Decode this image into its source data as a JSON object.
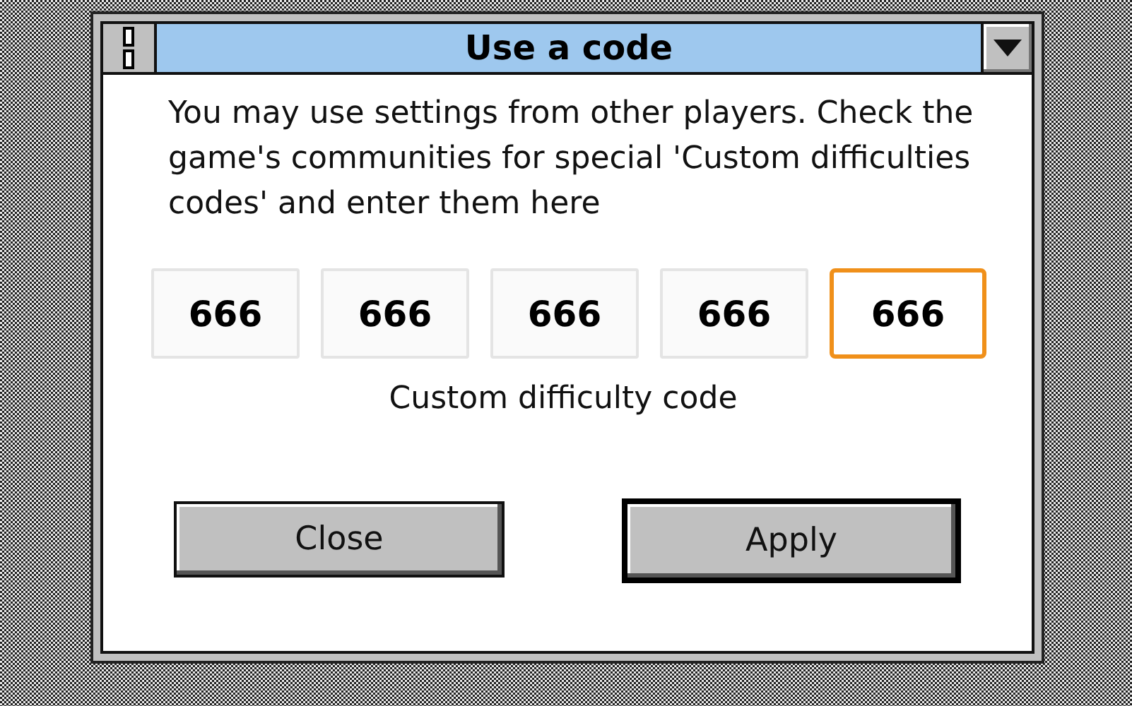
{
  "window": {
    "title": "Use a code"
  },
  "message": "You may use settings from other players. Check the game's communities for special 'Custom difficulties codes' and enter them here",
  "code_fields": [
    {
      "value": "666",
      "focused": false
    },
    {
      "value": "666",
      "focused": false
    },
    {
      "value": "666",
      "focused": false
    },
    {
      "value": "666",
      "focused": false
    },
    {
      "value": "666",
      "focused": true
    }
  ],
  "field_caption": "Custom difficulty code",
  "buttons": [
    {
      "label": "Close",
      "default": false
    },
    {
      "label": "Apply",
      "default": true
    }
  ]
}
